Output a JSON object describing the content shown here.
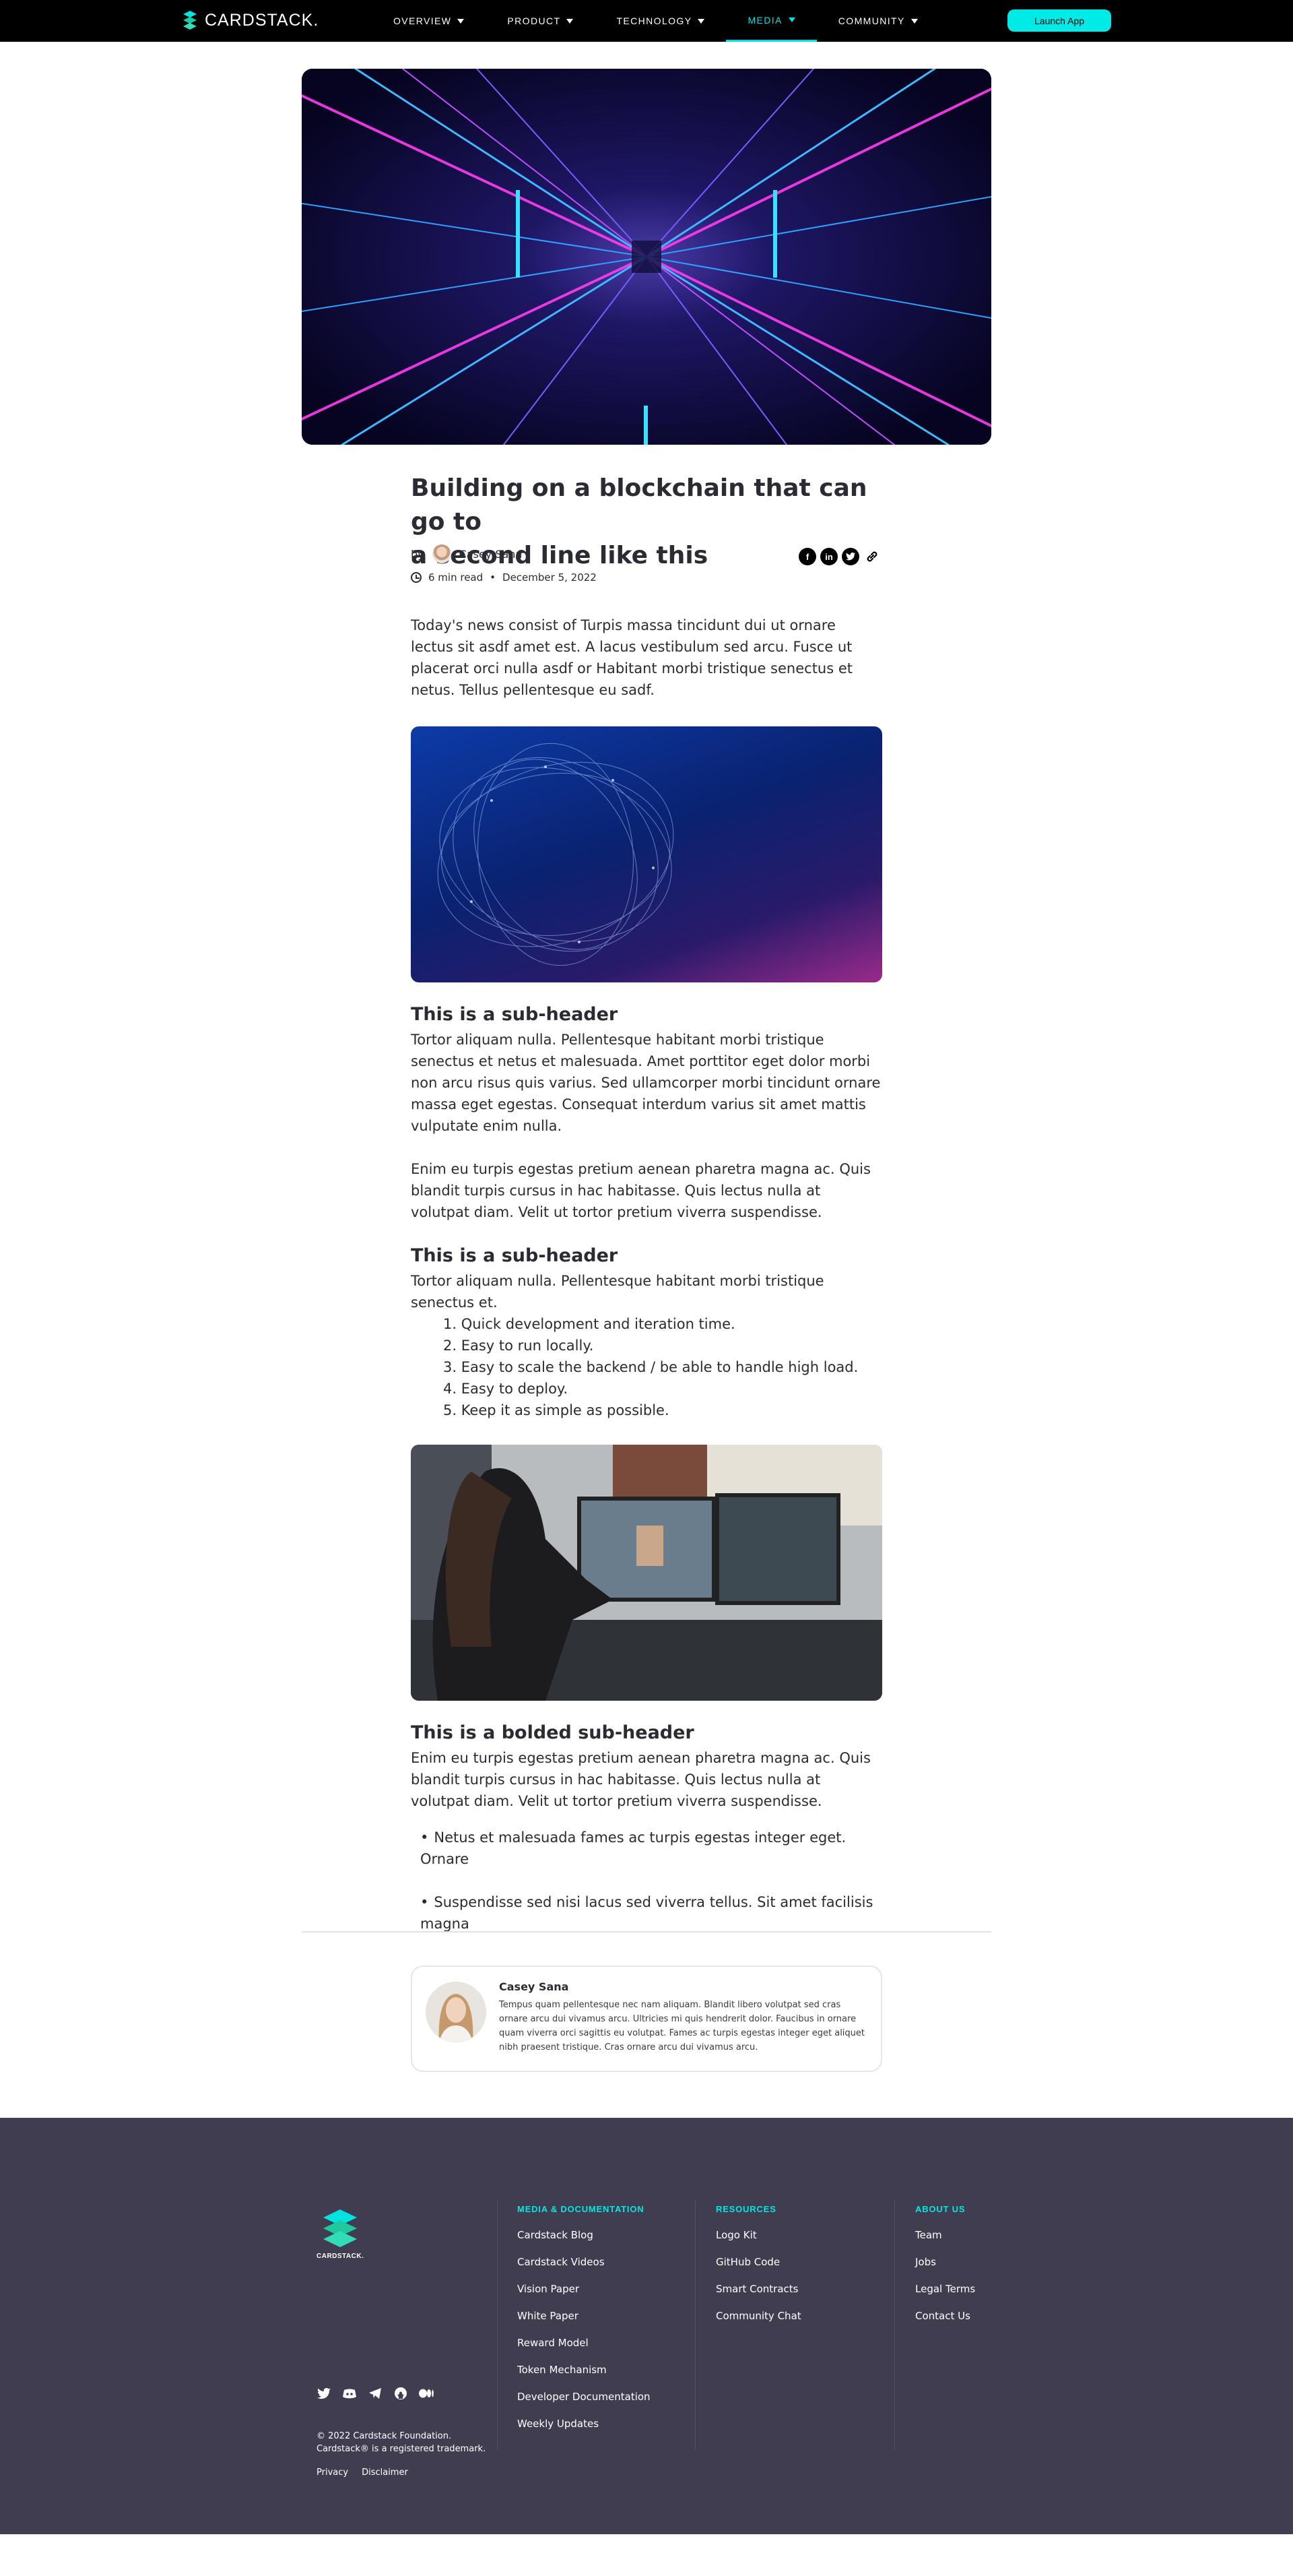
{
  "nav": {
    "brand": "CARDSTACK.",
    "items": [
      {
        "label": "OVERVIEW"
      },
      {
        "label": "PRODUCT"
      },
      {
        "label": "TECHNOLOGY"
      },
      {
        "label": "MEDIA"
      },
      {
        "label": "COMMUNITY"
      }
    ],
    "active": "MEDIA",
    "launch_label": "Launch App"
  },
  "article": {
    "title_line1": "Building on a blockchain that can go to",
    "title_line2": "a second line like this",
    "by_label": "by",
    "author": "Casey Sana",
    "read_time": "6 min read",
    "separator": "•",
    "date": "December 5, 2022",
    "share": [
      "facebook-icon",
      "linkedin-icon",
      "twitter-icon",
      "link-icon"
    ],
    "intro": "Today's news consist of Turpis massa tincidunt dui ut ornare lectus sit asdf amet est. A lacus vestibulum sed arcu. Fusce ut placerat orci nulla asdf or Habitant morbi tristique senectus et netus. Tellus pellentesque eu sadf.",
    "section1": {
      "heading": "This is a sub-header",
      "para1": "Tortor aliquam nulla. Pellentesque habitant morbi tristique senectus et netus et malesuada. Amet porttitor eget dolor morbi non arcu risus quis varius. Sed ullamcorper morbi tincidunt ornare massa eget egestas. Consequat interdum varius sit amet mattis vulputate enim nulla.",
      "para2": "Enim eu turpis egestas pretium aenean pharetra magna ac. Quis blandit turpis cursus in hac habitasse. Quis lectus nulla at volutpat diam. Velit ut tortor pretium viverra suspendisse."
    },
    "section2": {
      "heading": "This is a sub-header",
      "lead": "Tortor aliquam nulla. Pellentesque habitant morbi tristique senectus et.",
      "steps": [
        "1. Quick development and iteration time.",
        "2. Easy to run locally.",
        "3. Easy to scale the backend / be able to handle high load.",
        "4. Easy to deploy.",
        "5. Keep it as simple as possible."
      ]
    },
    "section3": {
      "heading": "This is a bolded sub-header",
      "para": "Enim eu turpis egestas pretium aenean pharetra magna ac. Quis blandit turpis cursus in hac habitasse. Quis lectus nulla at volutpat diam. Velit ut tortor pretium viverra suspendisse.",
      "bullets": [
        "Netus et malesuada fames ac turpis egestas integer eget. Ornare",
        "Suspendisse sed nisi lacus sed viverra tellus. Sit amet facilisis magna"
      ]
    }
  },
  "author_card": {
    "name": "Casey Sana",
    "bio": "Tempus quam pellentesque nec nam aliquam. Blandit libero volutpat sed cras ornare arcu dui vivamus arcu. Ultricies mi quis hendrerit dolor. Faucibus in ornare quam viverra orci sagittis eu volutpat. Fames ac turpis egestas integer eget aliquet nibh praesent tristique. Cras ornare arcu dui vivamus arcu."
  },
  "footer": {
    "brand": "CARDSTACK.",
    "columns": [
      {
        "heading": "MEDIA & DOCUMENTATION",
        "links": [
          "Cardstack Blog",
          "Cardstack Videos",
          "Vision Paper",
          "White Paper",
          "Reward Model",
          "Token Mechanism",
          "Developer Documentation",
          "Weekly Updates"
        ]
      },
      {
        "heading": "RESOURCES",
        "links": [
          "Logo Kit",
          "GitHub Code",
          "Smart Contracts",
          "Community Chat"
        ]
      },
      {
        "heading": "ABOUT US",
        "links": [
          "Team",
          "Jobs",
          "Legal Terms",
          "Contact Us"
        ]
      }
    ],
    "social": [
      "twitter-icon",
      "discord-icon",
      "telegram-icon",
      "github-icon",
      "medium-icon"
    ],
    "copyright_line1": "© 2022 Cardstack Foundation.",
    "copyright_line2": "Cardstack® is a registered trademark.",
    "legal": [
      "Privacy",
      "Disclaimer"
    ]
  },
  "colors": {
    "accent": "#00ebe5",
    "nav_bg": "#000000",
    "footer_bg": "#403d50",
    "text": "#2b2b33"
  }
}
